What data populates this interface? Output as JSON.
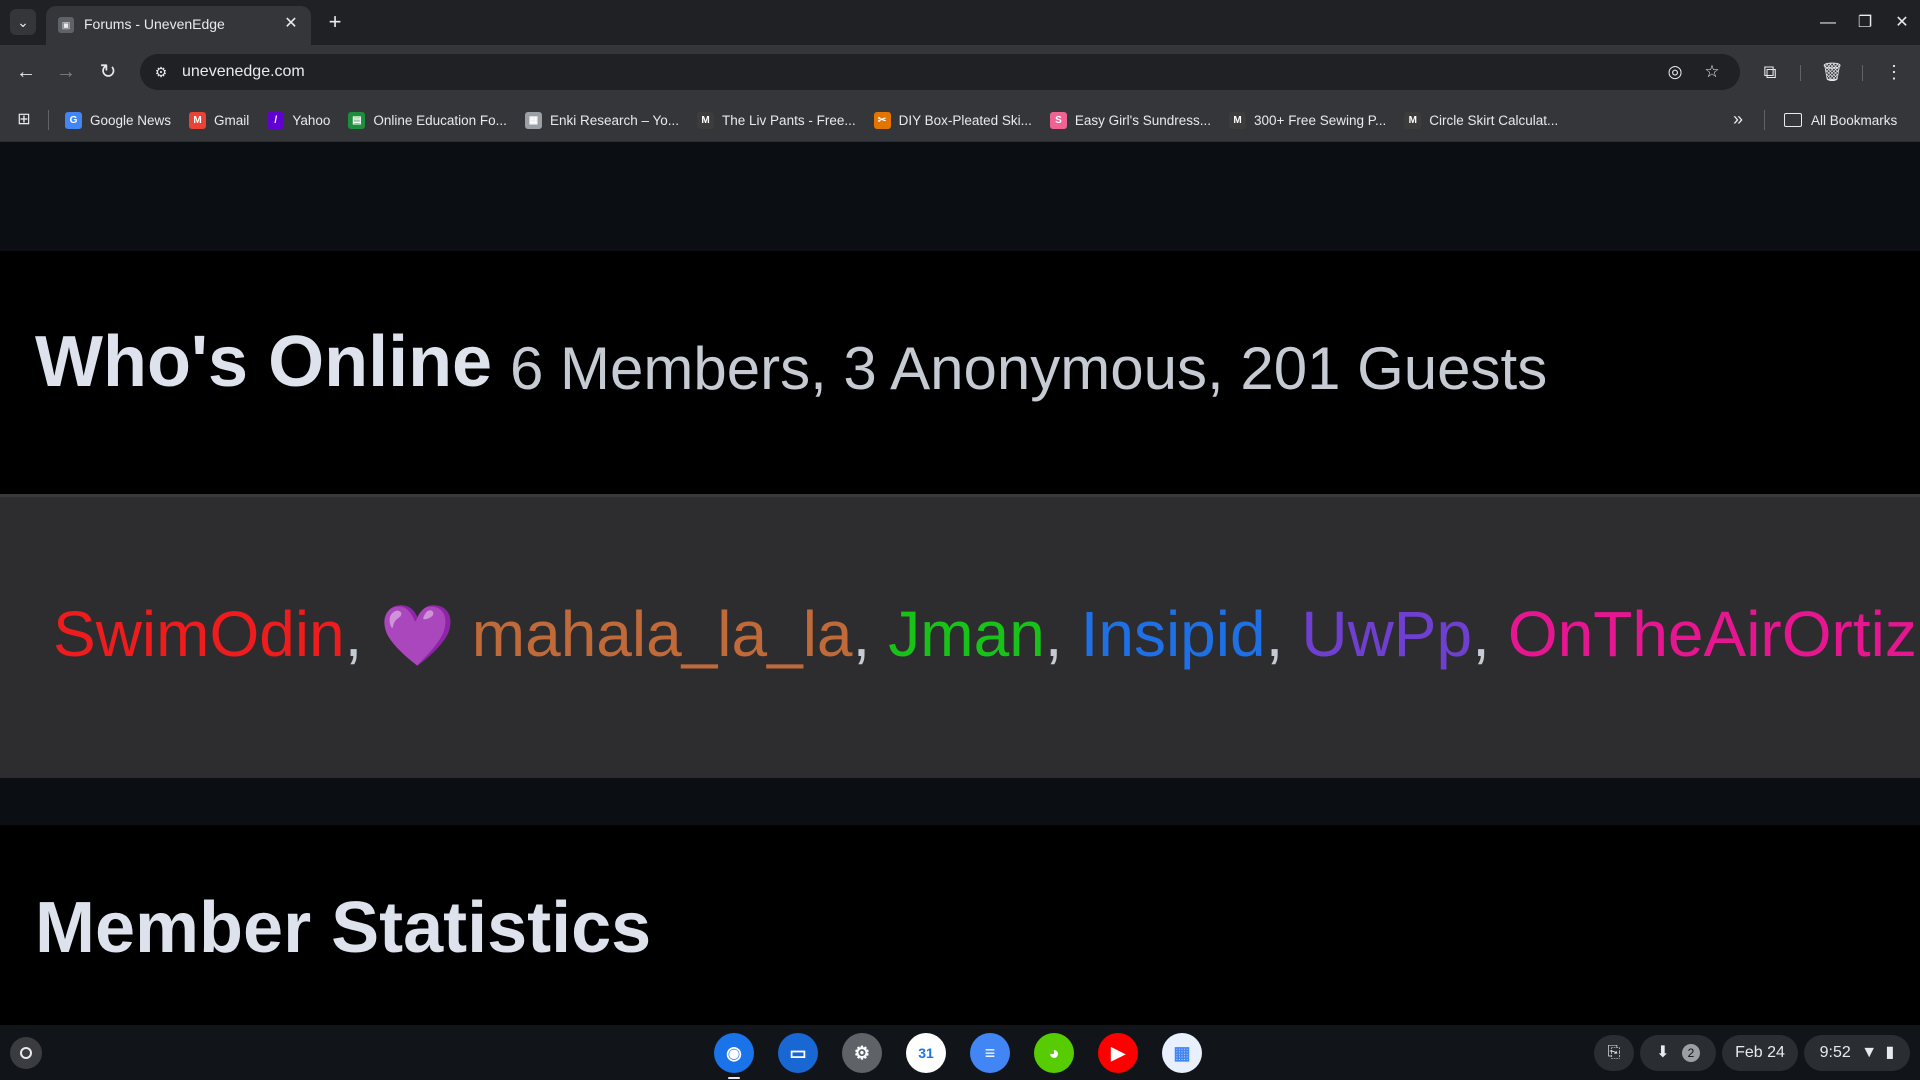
{
  "browser": {
    "tab": {
      "favicon": "forum-favicon",
      "title": "Forums - UnevenEdge"
    },
    "url": "unevenedge.com",
    "bookmarks": [
      {
        "icon": "google-news-icon",
        "color": "#4285f4",
        "glyph": "G",
        "label": "Google News"
      },
      {
        "icon": "gmail-icon",
        "color": "#ea4335",
        "glyph": "M",
        "label": "Gmail"
      },
      {
        "icon": "yahoo-icon",
        "color": "#6001d2",
        "glyph": "/",
        "label": "Yahoo"
      },
      {
        "icon": "education-icon",
        "color": "#1e8e3e",
        "glyph": "▤",
        "label": "Online Education Fo..."
      },
      {
        "icon": "enki-icon",
        "color": "#9aa0a6",
        "glyph": "▦",
        "label": "Enki Research – Yo..."
      },
      {
        "icon": "mood-icon",
        "color": "#3c3c3c",
        "glyph": "M",
        "label": "The Liv Pants - Free..."
      },
      {
        "icon": "diy-icon",
        "color": "#e37400",
        "glyph": "✂",
        "label": "DIY Box-Pleated Ski..."
      },
      {
        "icon": "sundress-icon",
        "color": "#f06292",
        "glyph": "S",
        "label": "Easy Girl's Sundress..."
      },
      {
        "icon": "mood-icon",
        "color": "#3c3c3c",
        "glyph": "M",
        "label": "300+ Free Sewing P..."
      },
      {
        "icon": "mood-icon",
        "color": "#3c3c3c",
        "glyph": "M",
        "label": "Circle Skirt Calculat..."
      }
    ],
    "all_bookmarks_label": "All Bookmarks"
  },
  "page": {
    "whos_online": {
      "title": "Who's Online",
      "summary": "6 Members, 3 Anonymous, 201 Guests"
    },
    "members": [
      {
        "name": "SwimOdin",
        "color": "#ee1c1c",
        "prefix": ""
      },
      {
        "name": "mahala_la_la",
        "color": "#c06a3a",
        "prefix": "💜"
      },
      {
        "name": "Jman",
        "color": "#19c219",
        "prefix": ""
      },
      {
        "name": "Insipid",
        "color": "#1f6fe5",
        "prefix": ""
      },
      {
        "name": "UwPp",
        "color": "#6f3fd0",
        "prefix": ""
      },
      {
        "name": "OnTheAirOrtiz",
        "color": "#e5168f",
        "prefix": ""
      }
    ],
    "separator": ",",
    "member_stats_title": "Member Statistics"
  },
  "shelf": {
    "apps": [
      {
        "name": "chrome-app",
        "color": "#1a73e8"
      },
      {
        "name": "files-app",
        "color": "#1967d2"
      },
      {
        "name": "settings-app",
        "color": "#5f6368"
      },
      {
        "name": "calendar-app",
        "color": "#ffffff"
      },
      {
        "name": "docs-app",
        "color": "#4285f4"
      },
      {
        "name": "duolingo-app",
        "color": "#58cc02"
      },
      {
        "name": "youtube-app",
        "color": "#ff0000"
      },
      {
        "name": "web-app",
        "color": "#e8f0fe"
      }
    ],
    "calendar_glyph": "31",
    "notification_count": "2",
    "date": "Feb 24",
    "time": "9:52"
  }
}
